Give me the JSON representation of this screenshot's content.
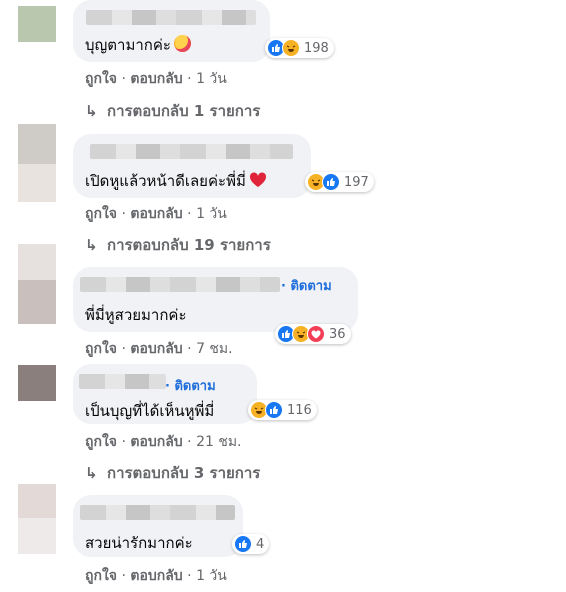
{
  "actions": {
    "like": "ถูกใจ",
    "reply": "ตอบกลับ",
    "separator": "·"
  },
  "comments": [
    {
      "text": "บุญตามากค่ะ",
      "emoji": "smiling-face-with-hearts",
      "reactions": [
        "like",
        "haha"
      ],
      "reaction_count": "198",
      "time": "1 วัน",
      "replies_label": "การตอบกลับ 1 รายการ"
    },
    {
      "text": "เปิดหูแล้วหน้าดีเลยค่ะพี่มี่",
      "emoji": "red-heart",
      "reactions": [
        "haha",
        "like"
      ],
      "reaction_count": "197",
      "time": "1 วัน",
      "replies_label": "การตอบกลับ 19 รายการ"
    },
    {
      "follow_label": "ติดตาม",
      "text": "พี่มี่หูสวยมากค่ะ",
      "reactions": [
        "like",
        "haha",
        "love"
      ],
      "reaction_count": "36",
      "time": "7 ชม."
    },
    {
      "follow_label": "ติดตาม",
      "text": "เป็นบุญที่ได้เห็นหูพี่มี่",
      "reactions": [
        "haha",
        "like"
      ],
      "reaction_count": "116",
      "time": "21 ชม.",
      "replies_label": "การตอบกลับ 3 รายการ"
    },
    {
      "text": "สวยน่ารักมากค่ะ",
      "reactions": [
        "like"
      ],
      "reaction_count": "4",
      "time": "1 วัน"
    }
  ],
  "colors": {
    "bubble": "#f0f2f5",
    "muted_text": "#65676b",
    "link_blue": "#216fdb",
    "like_blue": "#1877f2",
    "haha_yellow": "#f7b125",
    "love_red": "#f33e58"
  }
}
